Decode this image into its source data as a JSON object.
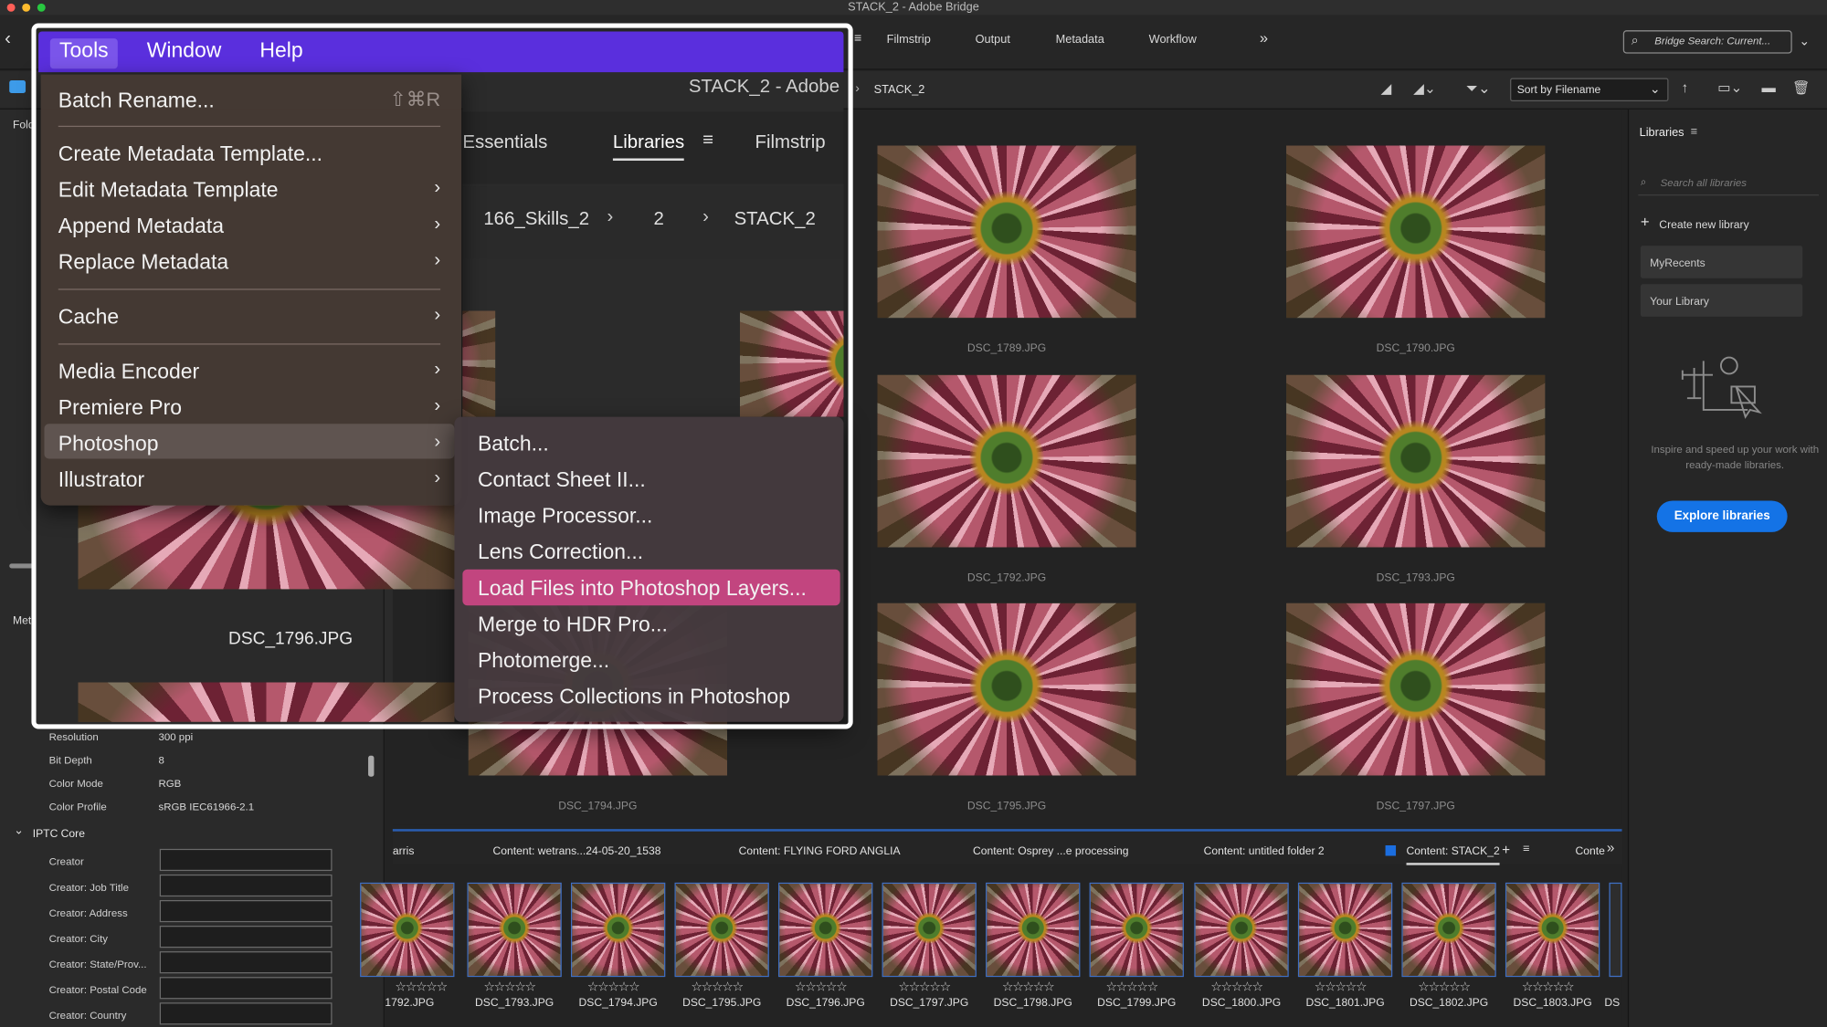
{
  "window": {
    "title": "STACK_2 - Adobe Bridge"
  },
  "toolbar": {
    "workspaces": [
      "Filmstrip",
      "Output",
      "Metadata",
      "Workflow"
    ],
    "overflow": "»",
    "search_placeholder": "Bridge Search: Current..."
  },
  "pathbar": {
    "current": "STACK_2",
    "sort_label": "Sort by Filename"
  },
  "menubar": {
    "items": [
      "Tools",
      "Window",
      "Help"
    ],
    "active": "Tools"
  },
  "tools_menu": {
    "items": [
      {
        "label": "Batch Rename...",
        "shortcut": "⇧⌘R"
      },
      {
        "label": "Create Metadata Template..."
      },
      {
        "label": "Edit Metadata Template",
        "submenu": true
      },
      {
        "label": "Append Metadata",
        "submenu": true
      },
      {
        "label": "Replace Metadata",
        "submenu": true
      },
      {
        "label": "Cache",
        "submenu": true
      },
      {
        "label": "Media Encoder",
        "submenu": true
      },
      {
        "label": "Premiere Pro",
        "submenu": true
      },
      {
        "label": "Photoshop",
        "submenu": true,
        "highlighted": true
      },
      {
        "label": "Illustrator",
        "submenu": true
      }
    ]
  },
  "photoshop_submenu": {
    "items": [
      "Batch...",
      "Contact Sheet II...",
      "Image Processor...",
      "Lens Correction...",
      "Load Files into Photoshop Layers...",
      "Merge to HDR Pro...",
      "Photomerge...",
      "Process Collections in Photoshop"
    ],
    "highlighted": "Load Files into Photoshop Layers..."
  },
  "background_window": {
    "title": "STACK_2 - Adobe",
    "tabs": [
      "Essentials",
      "Libraries",
      "Filmstrip"
    ],
    "breadcrumb": [
      "166_Skills_2",
      "2",
      "STACK_2"
    ],
    "thumb_caption": "DSC_1796.JPG"
  },
  "left_panel": {
    "folders_label": "Fold",
    "metadata_label": "Met",
    "file_props": [
      {
        "label": "Resolution",
        "value": "300 ppi"
      },
      {
        "label": "Bit Depth",
        "value": "8"
      },
      {
        "label": "Color Mode",
        "value": "RGB"
      },
      {
        "label": "Color Profile",
        "value": "sRGB IEC61966-2.1"
      }
    ],
    "iptc_header": "IPTC Core",
    "iptc_fields": [
      "Creator",
      "Creator: Job Title",
      "Creator: Address",
      "Creator: City",
      "Creator: State/Prov...",
      "Creator: Postal Code",
      "Creator: Country"
    ]
  },
  "content": {
    "thumbs": [
      "DSC_1789.JPG",
      "DSC_1790.JPG",
      "DSC_1792.JPG",
      "DSC_1793.JPG",
      "DSC_1794.JPG",
      "DSC_1795.JPG",
      "DSC_1797.JPG"
    ]
  },
  "libraries_panel": {
    "title": "Libraries",
    "search_placeholder": "Search all libraries",
    "create_label": "Create new library",
    "libraries": [
      "MyRecents",
      "Your Library"
    ],
    "promo": "Inspire and speed up your work with ready-made libraries.",
    "explore_label": "Explore libraries"
  },
  "collections": {
    "tabs": [
      "arris",
      "Content: wetrans...24-05-20_1538",
      "Content: FLYING FORD ANGLIA",
      "Content: Osprey ...e processing",
      "Content: untitled folder 2",
      "Content: STACK_2",
      "Conte"
    ],
    "active": "Content: STACK_2",
    "overflow": "»"
  },
  "filmstrip": {
    "items": [
      "1792.JPG",
      "DSC_1793.JPG",
      "DSC_1794.JPG",
      "DSC_1795.JPG",
      "DSC_1796.JPG",
      "DSC_1797.JPG",
      "DSC_1798.JPG",
      "DSC_1799.JPG",
      "DSC_1800.JPG",
      "DSC_1801.JPG",
      "DSC_1802.JPG",
      "DSC_1803.JPG",
      "DS"
    ],
    "stars": "☆☆☆☆☆"
  },
  "colors": {
    "menubar": "#5a2fdd",
    "highlight": "#c2457f",
    "photoshop_row": "#5f5450",
    "accent": "#2a5db0",
    "explore_button": "#1473e6"
  }
}
